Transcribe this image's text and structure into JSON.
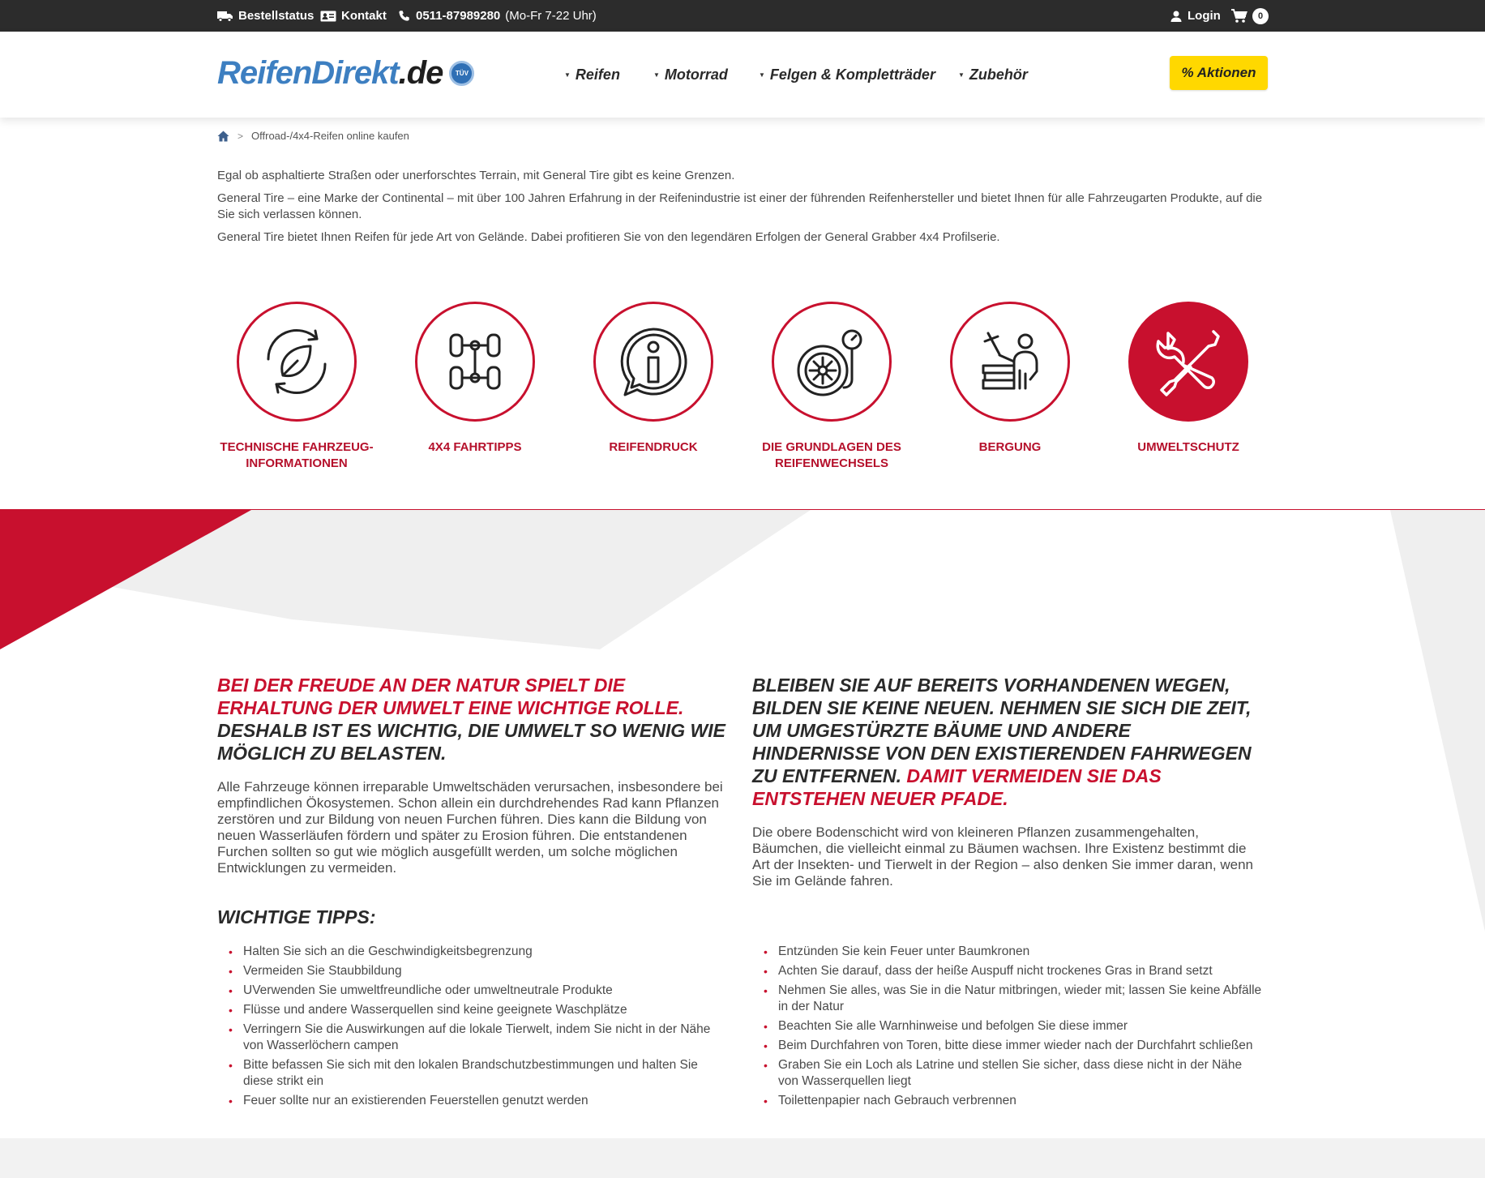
{
  "topbar": {
    "order_status": "Bestellstatus",
    "contact": "Kontakt",
    "phone": "0511-87989280",
    "hours": "(Mo-Fr 7-22 Uhr)",
    "login": "Login",
    "cart_count": "0"
  },
  "header": {
    "logo_part1": "ReifenDirekt",
    "logo_part2": ".de",
    "tuv": "TÜV",
    "nav": [
      {
        "label": "Reifen"
      },
      {
        "label": "Motorrad"
      },
      {
        "label": "Felgen & Kompletträder"
      },
      {
        "label": "Zubehör"
      }
    ],
    "aktionen": "% Aktionen"
  },
  "breadcrumb": {
    "current": "Offroad-/4x4-Reifen online kaufen"
  },
  "intro": [
    "Egal ob asphaltierte Straßen oder unerforschtes Terrain, mit General Tire gibt es keine Grenzen.",
    "General Tire – eine Marke der Continental – mit über 100 Jahren Erfahrung in der Reifenindustrie ist einer der führenden Reifenhersteller und bietet Ihnen für alle Fahrzeugarten Produkte, auf die Sie sich verlassen können.",
    "General Tire bietet Ihnen Reifen für jede Art von Gelände. Dabei profitieren Sie von den legendären Erfolgen der General Grabber 4x4 Profilserie."
  ],
  "features": [
    {
      "label": "Technische Fahrzeug-Informationen",
      "icon": "eco-cycle-icon"
    },
    {
      "label": "4x4 Fahrtipps",
      "icon": "axle-chassis-icon"
    },
    {
      "label": "Reifendruck",
      "icon": "info-bubble-icon"
    },
    {
      "label": "Die Grundlagen des Reifenwechsels",
      "icon": "tire-gauge-icon"
    },
    {
      "label": "Bergung",
      "icon": "person-tools-icon"
    },
    {
      "label": "Umweltschutz",
      "icon": "wrench-screwdriver-icon"
    }
  ],
  "left_column": {
    "headline_red": "Bei der Freude an der Natur spielt die Erhaltung der Umwelt eine wichtige Rolle.",
    "headline_dark": " Deshalb ist es wichtig, die Umwelt so wenig wie möglich zu belasten.",
    "body": "Alle Fahrzeuge können irreparable Umweltschäden verursachen, insbesondere bei empfindlichen Ökosystemen. Schon allein ein durchdrehendes Rad kann Pflanzen zerstören und zur Bildung von neuen Furchen führen. Dies kann die Bildung von neuen Wasserläufen fördern und später zu Erosion führen. Die entstandenen Furchen sollten so gut wie möglich ausgefüllt werden, um solche möglichen Entwicklungen zu vermeiden."
  },
  "right_column": {
    "headline_dark": "Bleiben Sie auf bereits vorhandenen Wegen, bilden Sie keine neuen. Nehmen Sie sich die Zeit, um umgestürzte Bäume und andere Hindernisse von den existierenden Fahrwegen zu entfernen. ",
    "headline_red": "Damit vermeiden Sie das Entstehen neuer Pfade.",
    "body": "Die obere Bodenschicht wird von kleineren Pflanzen zusammengehalten, Bäumchen, die vielleicht einmal zu Bäumen wachsen. Ihre Existenz bestimmt die Art der Insekten- und Tierwelt in der Region – also denken Sie immer daran, wenn Sie im Gelände fahren."
  },
  "tips": {
    "title": "Wichtige Tipps:",
    "left": [
      "Halten Sie sich an die Geschwindigkeitsbegrenzung",
      "Vermeiden Sie Staubbildung",
      "UVerwenden Sie umweltfreundliche oder umweltneutrale Produkte",
      "Flüsse und andere Wasserquellen sind keine geeignete Waschplätze",
      "Verringern Sie die Auswirkungen auf die lokale Tierwelt, indem Sie nicht in der Nähe von Wasserlöchern campen",
      "Bitte befassen Sie sich mit den lokalen Brandschutzbestimmungen und halten Sie diese strikt ein",
      "Feuer sollte nur an existierenden Feuerstellen genutzt werden"
    ],
    "right": [
      "Entzünden Sie kein Feuer unter Baumkronen",
      "Achten Sie darauf, dass der heiße Auspuff nicht trockenes Gras in Brand setzt",
      "Nehmen Sie alles, was Sie in die Natur mitbringen, wieder mit; lassen Sie keine Abfälle in der Natur",
      "Beachten Sie alle Warnhinweise und befolgen Sie diese immer",
      "Beim Durchfahren von Toren, bitte diese immer wieder nach der Durchfahrt schließen",
      "Graben Sie ein Loch als Latrine und stellen Sie sicher, dass diese nicht in der Nähe von Wasserquellen liegt",
      "Toilettenpapier nach Gebrauch verbrennen"
    ]
  },
  "colors": {
    "brand_red": "#c8102e",
    "accent_yellow": "#ffd800",
    "topbar_bg": "#2c2c2c",
    "logo_blue": "#3d7fc1"
  }
}
